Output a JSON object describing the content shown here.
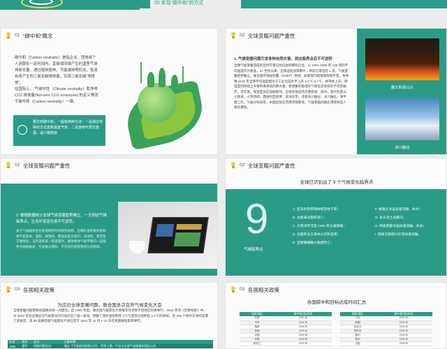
{
  "banner": {
    "tab_label": "05  实现“碳中和”的方式"
  },
  "colors": {
    "accent": "#2a9c86",
    "bulb": "#f3c93a"
  },
  "panel1": {
    "num": "01",
    "title": "“碳中和”概念",
    "para1": "碳中和（Carbon neutrality）是指企业、团体或个人测算在一定时间内，直接或间接产生的温室气体排放总量，通过植树造林、节能减排等形式，抵消自身产生的二氧化碳排放量，实现二氧化碳“零排放”。",
    "para2": "在国际上，“气候中性（Climate neutrality）和净零CO2 排放量(Net-zero CO2 emissions) 的定义等同于碳中和（Carbon neutrality）一致。",
    "box_text": "要达到碳中和，一般有两种方法：一是通过特殊的方式去除温室气体，二是使用可再生能源，减少碳排放"
  },
  "panel2": {
    "num": "02",
    "title": "全球变暖问题严重性",
    "lead": "1. 气候变暖问题引发多种自然灾害，到达临界点后不可逆转",
    "body": "全球气候变暖造成的自然灾害已经日益频繁和凸显，以 1901-2000 年 100 年的平均温度作为基准，21 世纪以来，全球温度加快攀升，目前已增温近 1 度。气候变暖趋势确立，联合国环境规划署（UNEP）预测，如果现行碳排放政策不变，将导致 2100 年全球平均温度相对于工业化前水平上升 3.4℃-3.7℃，并持续上升，而温度的持续上升将带来更高的降水量、更频繁的极端天气和生态系统的不可逆破坏。近年来，受温室效应加剧影响，全球多地自然灾害频发：加州、澳大利亚山火频发，火势持续；西伯利亚极寒、非洲大旱、北极冰川融化；冰川融化、海平面上升，气候分布异常，中国出现北涝南旱现象等。气候变暖问题必须得到全人类的重视。",
    "img1_caption": "澳大利亚山火",
    "img2_caption": "冰川融合"
  },
  "panel3": {
    "num": "02",
    "title": "全球变暖问题严重性",
    "lead": "2. 根据数据统计全球气候变暖趋势确立，一旦到达气候临界点，生态环境变化将不可逆转。",
    "body": "关于气候临界点也是地球历时的研究表明，全球升温带来的影响将不是渐进、温和、线性的，而往往是可能的、非线性、甚至是灾难性的。当升温到某一程度值时，维持地球气候平衡的一些临界点将被触发，引发难以预料、不可逆的突变和持久的影响。"
  },
  "panel4": {
    "num": "02",
    "title": "全球变暖问题严重性",
    "subtitle": "全球已识别出了 9 个气候变化临界点",
    "big_number": "9",
    "big_caption": "气候临界点",
    "points_left": [
      "A. 亚马孙热带雨林经常性干旱；",
      "B. 北极海冰面积减少；",
      "C. 大西洋环流自 1950 年以来放缓；",
      "D. 北美的北方森林火灾和虫害；",
      "E. 全球珊瑚礁大规模死亡；"
    ],
    "points_right": [
      "F. 格陵兰冰盖加速消融、失冰；",
      "G. 永久冻土层解冻；",
      "H. 南极西部冰盖加速消融、失冰；",
      "I. 南极东部部分区域加速消融。"
    ]
  },
  "panel5": {
    "num": "03",
    "title": "各国相关政策",
    "subtitle": "为应对全球变暖问题，联合国多次召开气候变化大会",
    "body": "全球变暖问题需要各国联合统一问题治。自 1995 年起，联合国气候变化大会每年在世界不同地区轮换举行。2015 年的《巴黎协定》中，对 2020 年后全球应对气候变化的行动作出了统一安排，明确了将升温控制在 2℃乃至努力控制在 1.5℃的目标。近 200 个缔约方共同签署了该协定。第 26 届联合国气候变化大会已定于 2021 年 11 月 1-12 日在英国格拉斯哥举行。",
    "table_headers": [
      "年份",
      "地点",
      "会议",
      "主要成果"
    ],
    "table_rows": [
      [
        "1992",
        "里约",
        "地球问题会议",
        "通过《气候变化框架公约》，世界上第一个应对全球气候变暖的国际公约"
      ]
    ]
  },
  "panel6": {
    "num": "03",
    "title": "各国相关政策",
    "subtitle": "各国碳中和目标达成时间汇总",
    "col_country": "国家/地区",
    "col_year": "碳中和目标时间",
    "left_rows": [
      [
        "苏里",
        "2050 年"
      ],
      [
        "不丹",
        "2050 年"
      ],
      [
        "瑞典",
        "2045 年"
      ],
      [
        "英国",
        "2050 年"
      ],
      [
        "法国",
        "2050 年"
      ],
      [
        "丹麦",
        "2050 年"
      ],
      [
        "新西兰",
        "2050 年"
      ],
      [
        "匈牙利",
        "2050 年"
      ]
    ],
    "right_rows": [
      [
        "日本",
        "2050 年"
      ],
      [
        "韩国",
        "2050 年"
      ],
      [
        "加拿大",
        "2050 年"
      ],
      [
        "西班牙",
        "2050 年"
      ],
      [
        "智利",
        "2050 年"
      ],
      [
        "斐济",
        "2050 年"
      ],
      [
        "中国",
        "2060 年"
      ],
      [
        "冰岛",
        "2040 年"
      ]
    ]
  }
}
